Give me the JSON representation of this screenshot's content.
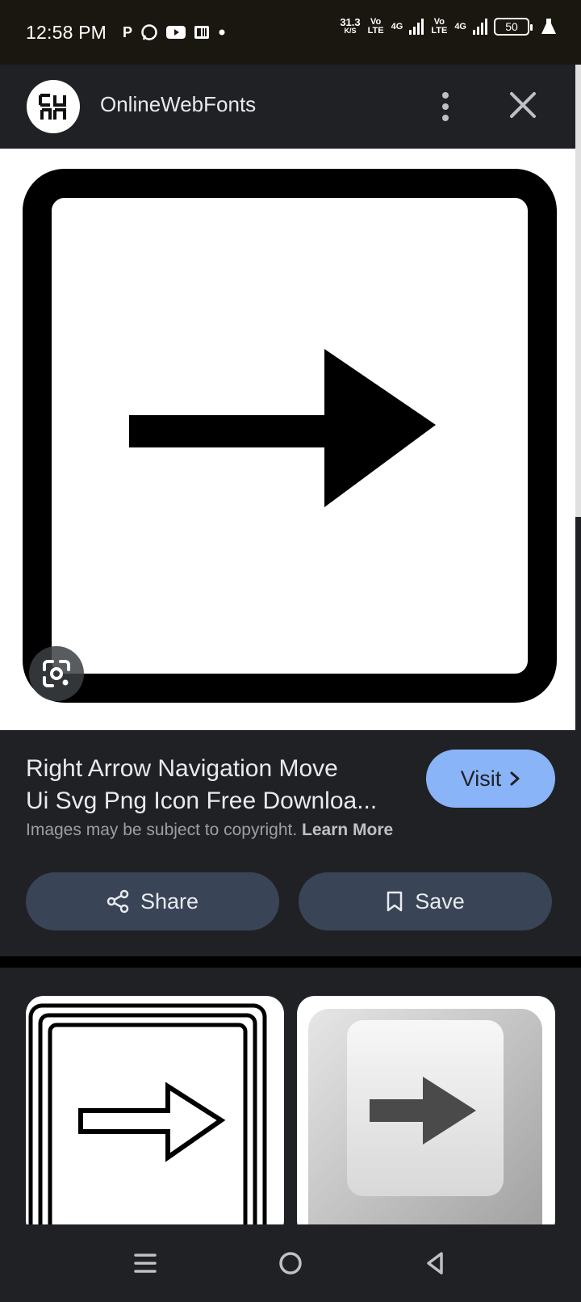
{
  "status_bar": {
    "time": "12:58 PM",
    "app_icons": [
      "P",
      "whatsapp-icon",
      "youtube-icon",
      "news-icon"
    ],
    "net_speed_value": "31.3",
    "net_speed_unit": "K/S",
    "sim1_label": "Vo LTE",
    "sim1_network": "4G",
    "sim2_label": "Vo LTE",
    "sim2_network": "4G",
    "battery": "50"
  },
  "header": {
    "site_name": "OnlineWebFonts"
  },
  "result": {
    "title_line1": "Right Arrow Navigation Move",
    "title_line2": "Ui Svg Png Icon Free Downloa...",
    "visit_label": "Visit",
    "copyright_text": "Images may be subject to copyright.",
    "learn_more": "Learn More",
    "share_label": "Share",
    "save_label": "Save"
  },
  "colors": {
    "accent": "#8ab4f8",
    "pill_bg": "#394457",
    "background": "#202124"
  }
}
